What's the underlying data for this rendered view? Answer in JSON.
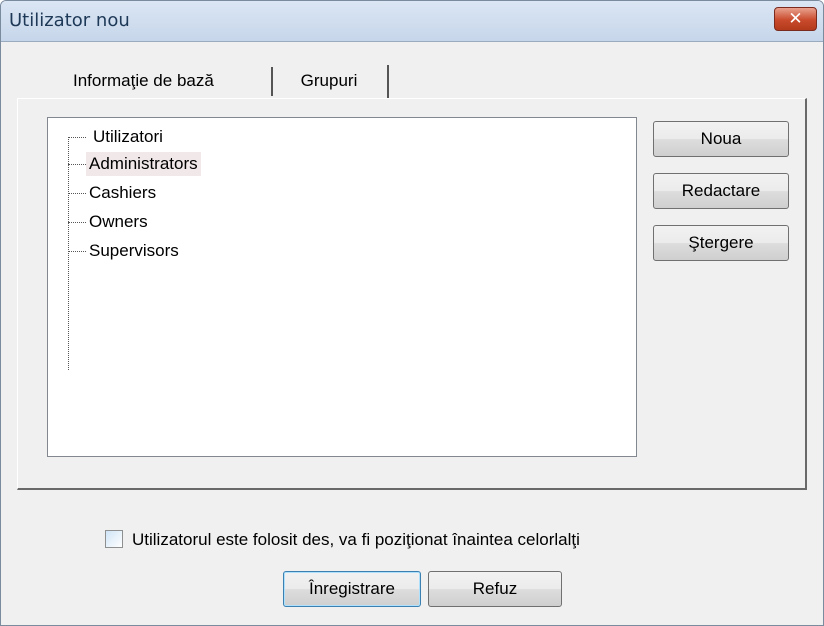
{
  "window": {
    "title": "Utilizator nou",
    "close_glyph": "✕"
  },
  "tabs": [
    {
      "label": "Informaţie de bază"
    },
    {
      "label": "Grupuri"
    }
  ],
  "tree": {
    "root": "Utilizatori",
    "items": [
      "Administrators",
      "Cashiers",
      "Owners",
      "Supervisors"
    ],
    "selected": "Administrators"
  },
  "side_buttons": {
    "new": "Noua",
    "edit": "Redactare",
    "delete": "Ştergere"
  },
  "frequent_checkbox": {
    "label": "Utilizatorul este folosit des, va fi poziţionat înaintea celorlalţi",
    "checked": false
  },
  "footer": {
    "save": "Înregistrare",
    "cancel": "Refuz"
  },
  "colors": {
    "titlebar": "#c6d6ea",
    "close": "#c94a2c",
    "dialog_bg": "#f0f0f0",
    "highlight": "#f1e9e9"
  },
  "icons": {
    "close": "close-icon"
  }
}
